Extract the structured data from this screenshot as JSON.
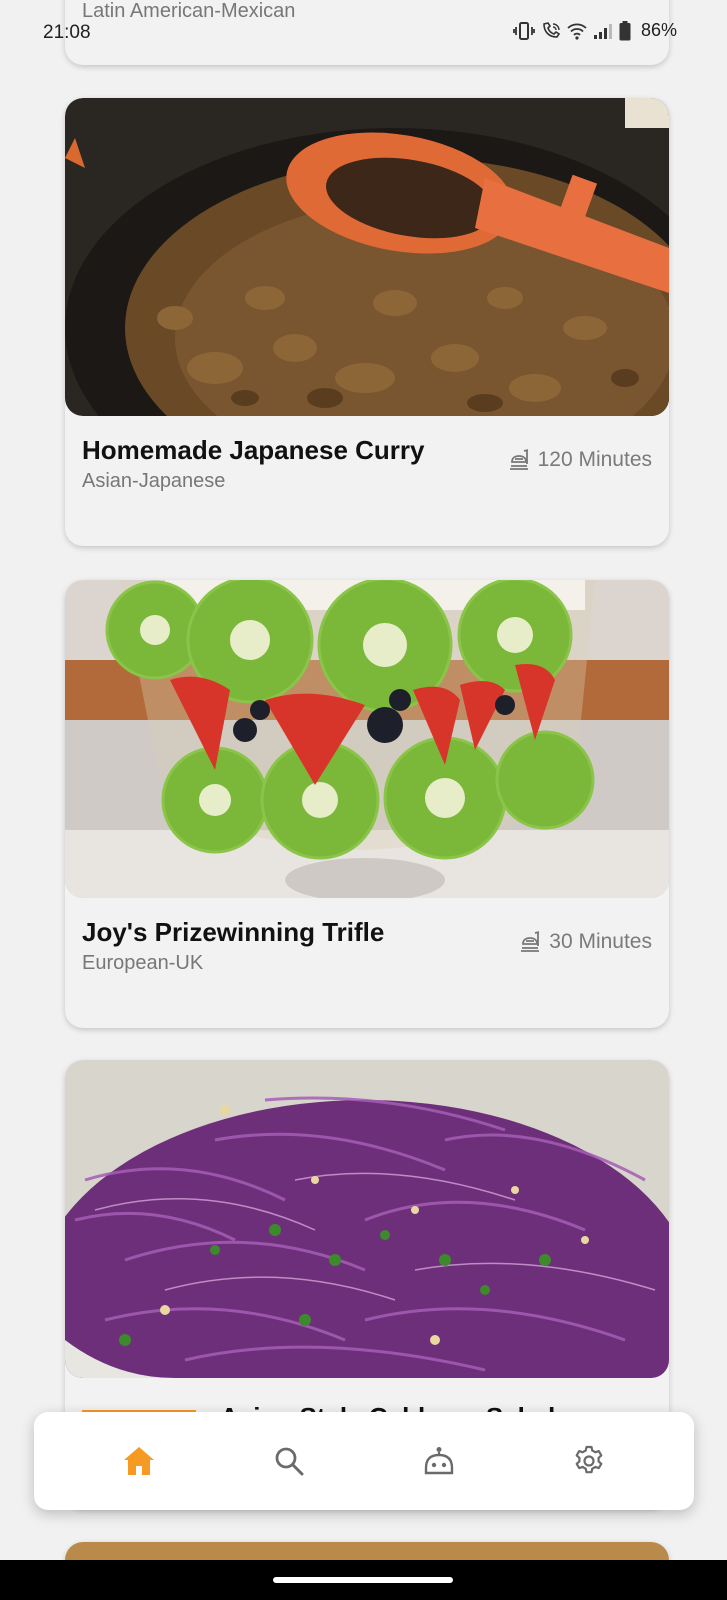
{
  "status_bar": {
    "time": "21:08",
    "battery": "86%"
  },
  "colors": {
    "accent": "#f59a23",
    "background": "#f1f1f1",
    "card": "#f2f2f2"
  },
  "recipes": [
    {
      "title": "",
      "cuisine": "Latin American-Mexican"
    },
    {
      "title": "Homemade Japanese Curry",
      "cuisine": "Asian-Japanese",
      "time": "120 Minutes",
      "image": "japanese-curry-photo"
    },
    {
      "title": "Joy's Prizewinning Trifle",
      "cuisine": "European-UK",
      "time": "30 Minutes",
      "image": "fruit-trifle-photo"
    },
    {
      "title": "Asian-Style Cabbage Salad",
      "image": "purple-cabbage-salad-photo"
    }
  ],
  "bottom_nav": [
    {
      "icon": "home-icon",
      "active": true
    },
    {
      "icon": "search-icon",
      "active": false
    },
    {
      "icon": "robot-icon",
      "active": false
    },
    {
      "icon": "settings-gear-icon",
      "active": false
    }
  ]
}
